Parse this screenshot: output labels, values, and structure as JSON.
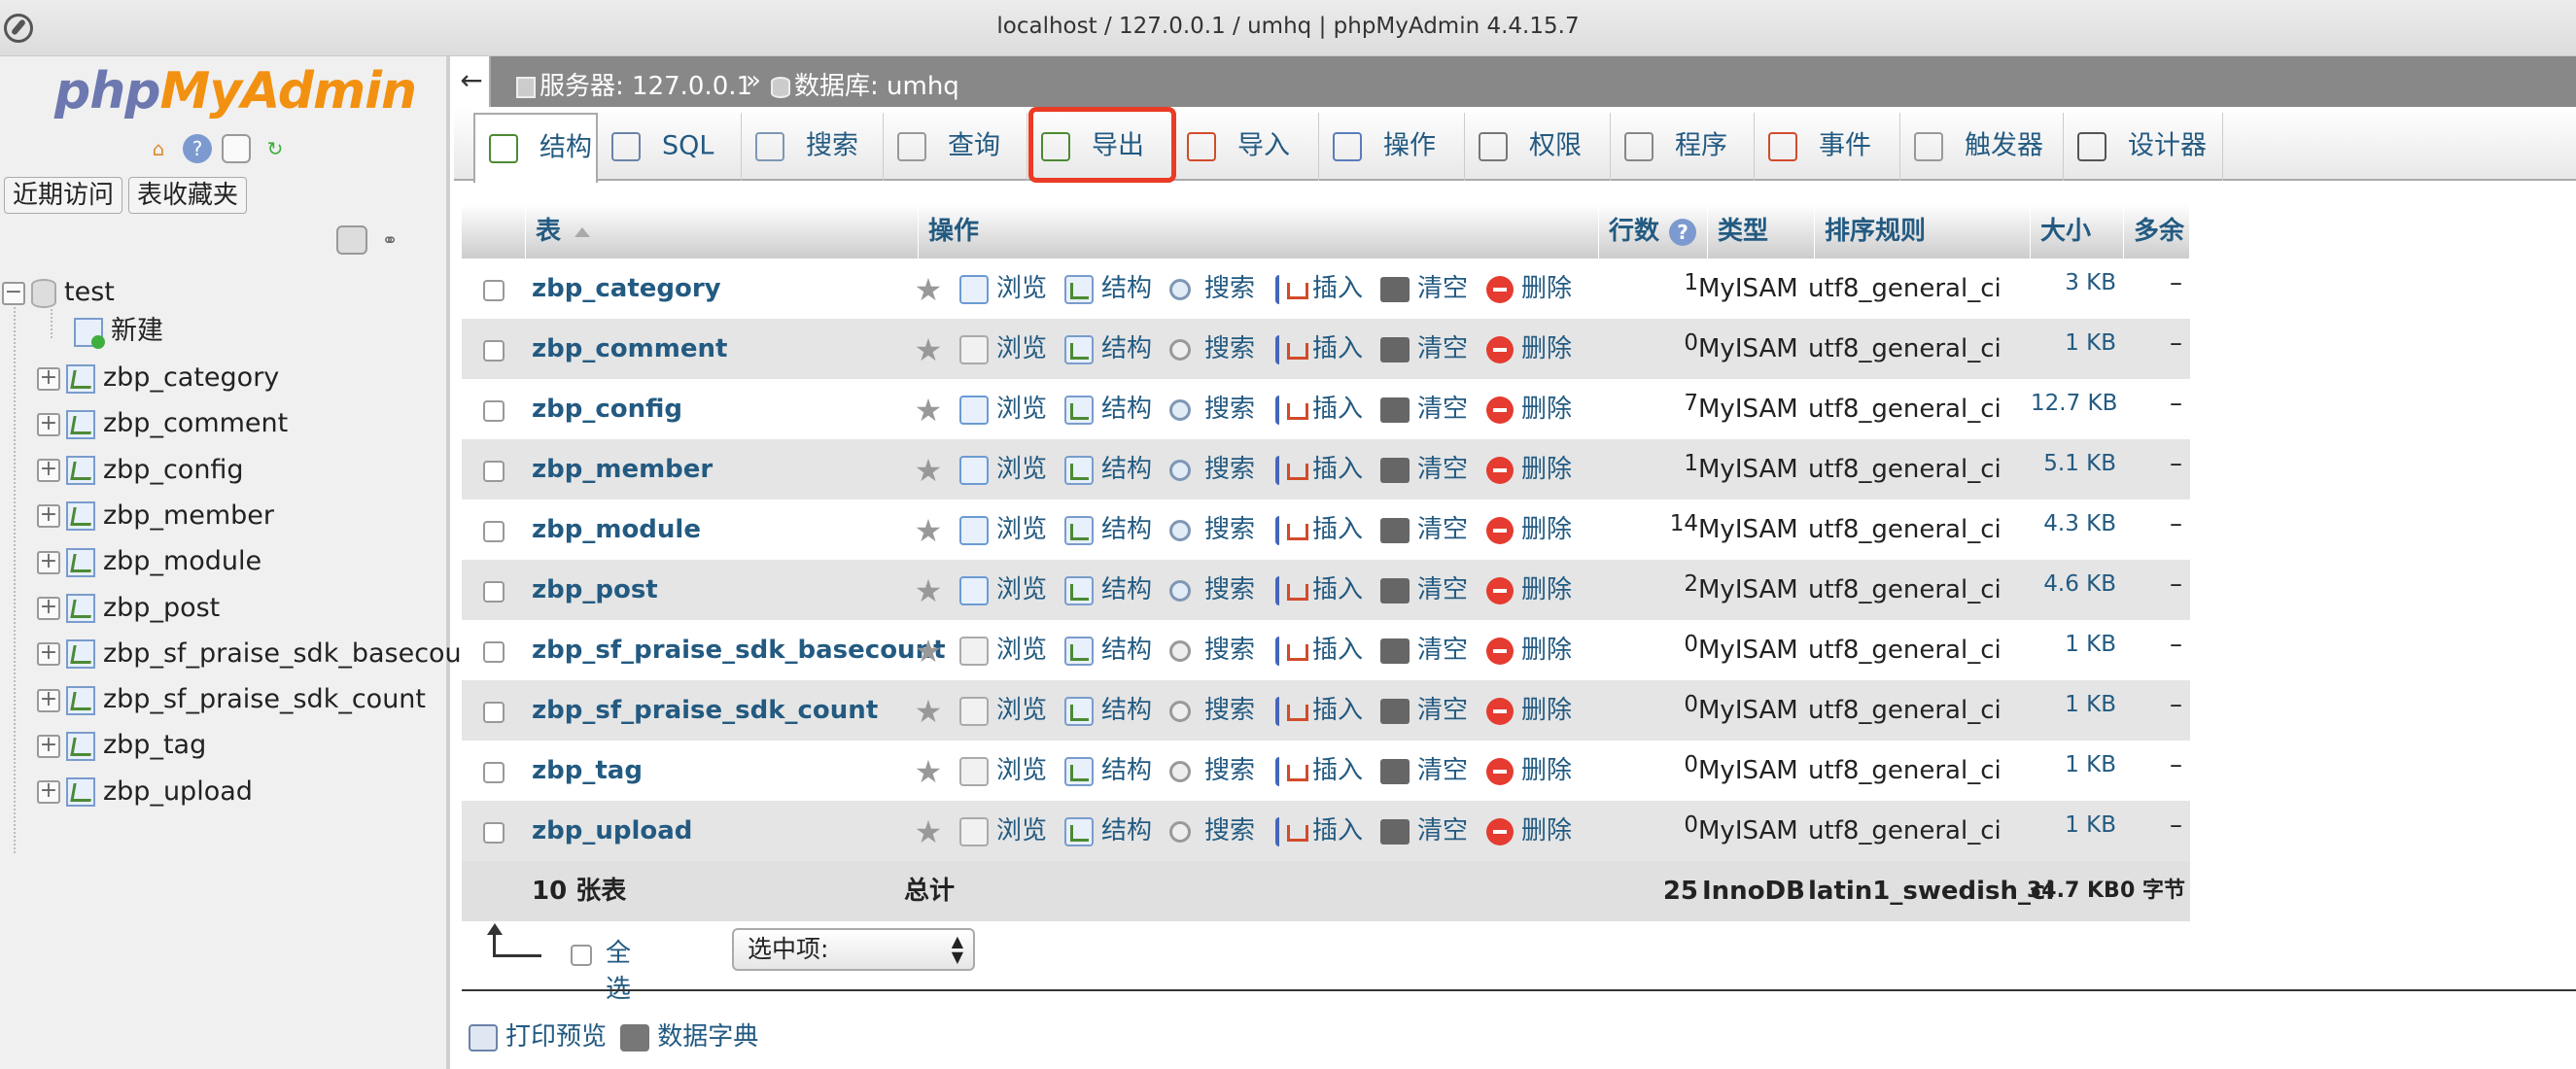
{
  "window": {
    "title": "localhost / 127.0.0.1 / umhq | phpMyAdmin 4.4.15.7"
  },
  "logo": {
    "php": "php",
    "my": "My",
    "admin": "Admin"
  },
  "nav": {
    "recent_label": "近期访问",
    "favorites_label": "表收藏夹",
    "tree": {
      "db_name": "test",
      "new_label": "新建",
      "tables": [
        "zbp_category",
        "zbp_comment",
        "zbp_config",
        "zbp_member",
        "zbp_module",
        "zbp_post",
        "zbp_sf_praise_sdk_basecour",
        "zbp_sf_praise_sdk_count",
        "zbp_tag",
        "zbp_upload"
      ]
    }
  },
  "breadcrumb": {
    "back": "←",
    "server_label": "服务器: 127.0.0.1",
    "sep": "»",
    "db_label": "数据库: umhq"
  },
  "tabs": [
    {
      "label": "结构",
      "icon": "structure-icon",
      "active": true
    },
    {
      "label": "SQL",
      "icon": "sql-icon"
    },
    {
      "label": "搜索",
      "icon": "search-icon"
    },
    {
      "label": "查询",
      "icon": "query-icon"
    },
    {
      "label": "导出",
      "icon": "export-icon",
      "highlighted": true
    },
    {
      "label": "导入",
      "icon": "import-icon"
    },
    {
      "label": "操作",
      "icon": "wrench-icon"
    },
    {
      "label": "权限",
      "icon": "privileges-icon"
    },
    {
      "label": "程序",
      "icon": "routines-icon"
    },
    {
      "label": "事件",
      "icon": "events-icon"
    },
    {
      "label": "触发器",
      "icon": "triggers-icon"
    },
    {
      "label": "设计器",
      "icon": "designer-icon"
    }
  ],
  "table": {
    "headers": {
      "table": "表",
      "actions": "操作",
      "rows": "行数",
      "type": "类型",
      "collation": "排序规则",
      "size": "大小",
      "overhead": "多余"
    },
    "actions": {
      "browse": "浏览",
      "structure": "结构",
      "search": "搜索",
      "insert": "插入",
      "empty": "清空",
      "drop": "删除"
    },
    "rows": [
      {
        "name": "zbp_category",
        "rows": "1",
        "type": "MyISAM",
        "collation": "utf8_general_ci",
        "size": "3 KB",
        "overhead": "–",
        "has_data": true
      },
      {
        "name": "zbp_comment",
        "rows": "0",
        "type": "MyISAM",
        "collation": "utf8_general_ci",
        "size": "1 KB",
        "overhead": "–",
        "has_data": false
      },
      {
        "name": "zbp_config",
        "rows": "7",
        "type": "MyISAM",
        "collation": "utf8_general_ci",
        "size": "12.7 KB",
        "overhead": "–",
        "has_data": true
      },
      {
        "name": "zbp_member",
        "rows": "1",
        "type": "MyISAM",
        "collation": "utf8_general_ci",
        "size": "5.1 KB",
        "overhead": "–",
        "has_data": true
      },
      {
        "name": "zbp_module",
        "rows": "14",
        "type": "MyISAM",
        "collation": "utf8_general_ci",
        "size": "4.3 KB",
        "overhead": "–",
        "has_data": true
      },
      {
        "name": "zbp_post",
        "rows": "2",
        "type": "MyISAM",
        "collation": "utf8_general_ci",
        "size": "4.6 KB",
        "overhead": "–",
        "has_data": true
      },
      {
        "name": "zbp_sf_praise_sdk_basecount",
        "rows": "0",
        "type": "MyISAM",
        "collation": "utf8_general_ci",
        "size": "1 KB",
        "overhead": "–",
        "has_data": false
      },
      {
        "name": "zbp_sf_praise_sdk_count",
        "rows": "0",
        "type": "MyISAM",
        "collation": "utf8_general_ci",
        "size": "1 KB",
        "overhead": "–",
        "has_data": false
      },
      {
        "name": "zbp_tag",
        "rows": "0",
        "type": "MyISAM",
        "collation": "utf8_general_ci",
        "size": "1 KB",
        "overhead": "–",
        "has_data": false
      },
      {
        "name": "zbp_upload",
        "rows": "0",
        "type": "MyISAM",
        "collation": "utf8_general_ci",
        "size": "1 KB",
        "overhead": "–",
        "has_data": false
      }
    ],
    "summary": {
      "count": "10 张表",
      "label": "总计",
      "rows": "25",
      "type": "InnoDB",
      "collation": "latin1_swedish_ci",
      "size": "34.7 KB",
      "overhead": "0 字节"
    }
  },
  "bulk": {
    "check_all": "全选",
    "with_selected": "选中项:"
  },
  "footer": {
    "print_view": "打印预览",
    "data_dictionary": "数据字典"
  },
  "colors": {
    "link": "#235a81",
    "export_highlight": "#ea3b24",
    "breadcrumb_bg": "#888888"
  }
}
